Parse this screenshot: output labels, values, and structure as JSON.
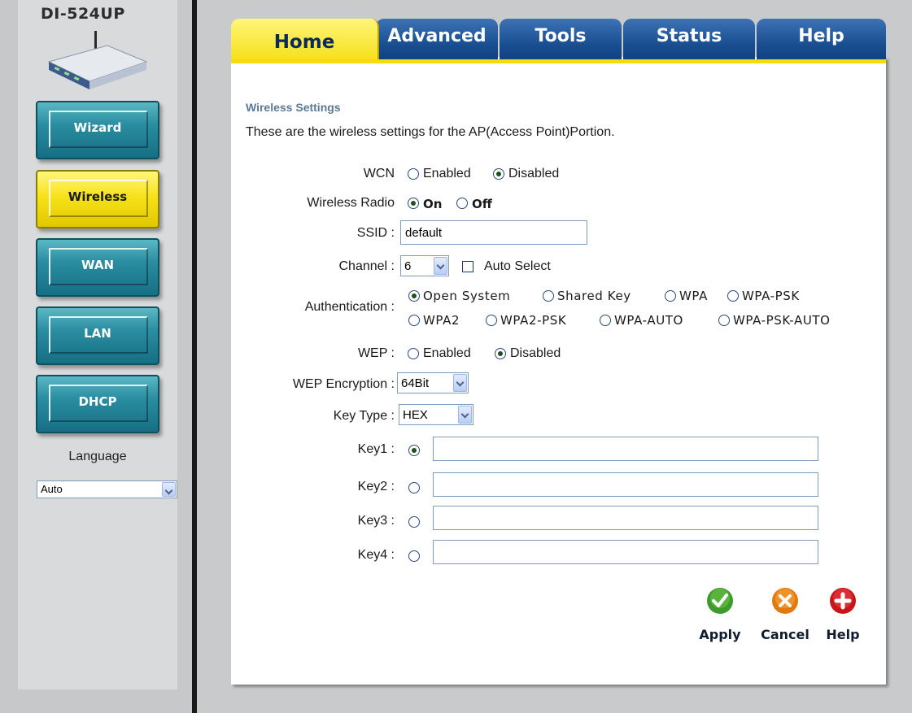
{
  "device": {
    "model": "DI-524UP"
  },
  "sidebar": {
    "buttons": [
      {
        "label": "Wizard"
      },
      {
        "label": "Wireless"
      },
      {
        "label": "WAN"
      },
      {
        "label": "LAN"
      },
      {
        "label": "DHCP"
      }
    ],
    "language_label": "Language",
    "language_value": "Auto"
  },
  "tabs": [
    {
      "label": "Home"
    },
    {
      "label": "Advanced"
    },
    {
      "label": "Tools"
    },
    {
      "label": "Status"
    },
    {
      "label": "Help"
    }
  ],
  "colors": {
    "accent_yellow": "#f5df16",
    "tab_blue": "#1a4f92",
    "nav_teal": "#2a8da0",
    "title_blue": "#5a7a96"
  },
  "page": {
    "section_title": "Wireless Settings",
    "description": "These are the wireless settings for the AP(Access Point)Portion."
  },
  "form": {
    "wcn": {
      "label": "WCN",
      "options": [
        "Enabled",
        "Disabled"
      ],
      "selected": "Disabled"
    },
    "radio": {
      "label": "Wireless Radio",
      "options": [
        "On",
        "Off"
      ],
      "selected": "On"
    },
    "ssid": {
      "label": "SSID :",
      "value": "default"
    },
    "channel": {
      "label": "Channel :",
      "value": "6",
      "auto_select_label": "Auto Select",
      "auto_select_checked": false
    },
    "authentication": {
      "label": "Authentication :",
      "options": [
        "Open System",
        "Shared Key",
        "WPA",
        "WPA-PSK",
        "WPA2",
        "WPA2-PSK",
        "WPA-AUTO",
        "WPA-PSK-AUTO"
      ],
      "selected": "Open System"
    },
    "wep": {
      "label": "WEP :",
      "options": [
        "Enabled",
        "Disabled"
      ],
      "selected": "Disabled"
    },
    "wep_encryption": {
      "label": "WEP Encryption :",
      "value": "64Bit"
    },
    "key_type": {
      "label": "Key Type :",
      "value": "HEX"
    },
    "keys": [
      {
        "label": "Key1 :",
        "value": "",
        "selected": true
      },
      {
        "label": "Key2 :",
        "value": "",
        "selected": false
      },
      {
        "label": "Key3 :",
        "value": "",
        "selected": false
      },
      {
        "label": "Key4 :",
        "value": "",
        "selected": false
      }
    ]
  },
  "actions": {
    "apply": "Apply",
    "cancel": "Cancel",
    "help": "Help"
  },
  "icons": {
    "apply": "checkmark-icon",
    "cancel": "x-icon",
    "help": "plus-icon"
  }
}
